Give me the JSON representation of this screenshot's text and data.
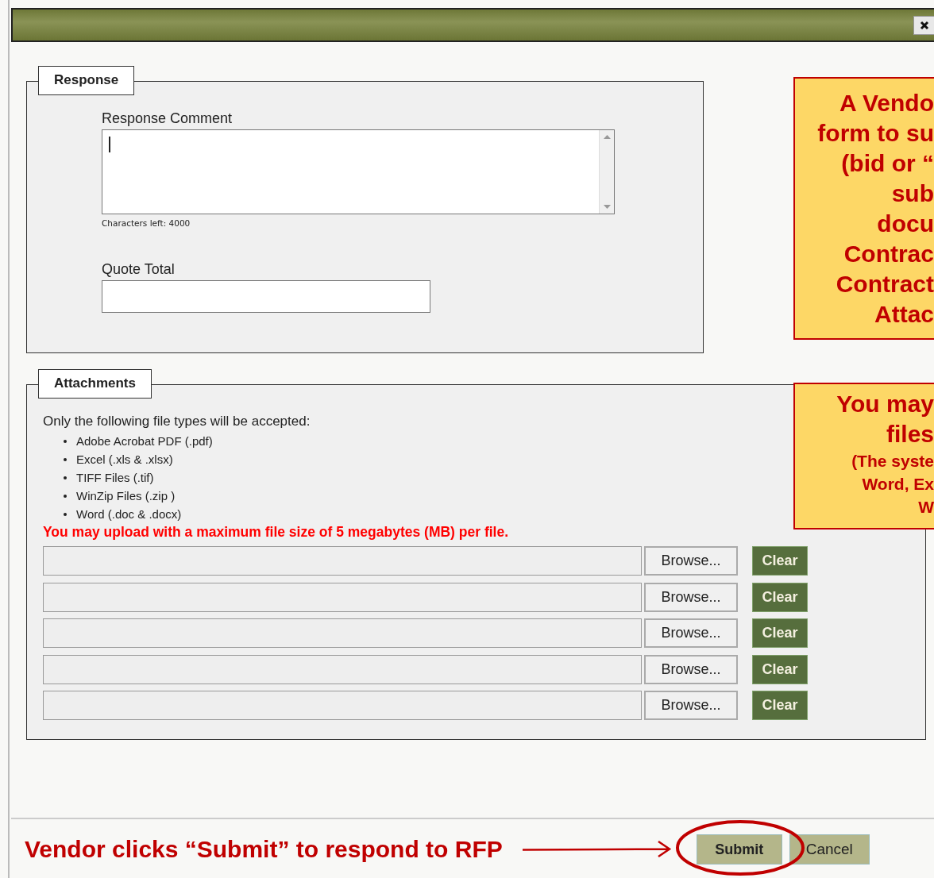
{
  "response": {
    "legend": "Response",
    "comment_label": "Response Comment",
    "chars_left": "Characters left: 4000",
    "quote_label": "Quote Total"
  },
  "attachments": {
    "legend": "Attachments",
    "intro": "Only the following file types will be accepted:",
    "file_types": [
      "Adobe Acrobat PDF (.pdf)",
      "Excel (.xls & .xlsx)",
      "TIFF Files (.tif)",
      "WinZip Files (.zip )",
      "Word (.doc & .docx)"
    ],
    "size_warning": "You may upload with a maximum file size of 5 megabytes (MB) per file.",
    "uploads": [
      {
        "browse": "Browse...",
        "clear": "Clear"
      },
      {
        "browse": "Browse...",
        "clear": "Clear"
      },
      {
        "browse": "Browse...",
        "clear": "Clear"
      },
      {
        "browse": "Browse...",
        "clear": "Clear"
      },
      {
        "browse": "Browse...",
        "clear": "Clear"
      }
    ]
  },
  "footer": {
    "pointer_text": "Vendor clicks “Submit” to respond to RFP",
    "buttons": [
      {
        "label": "Submit",
        "kind": "primary"
      },
      {
        "label": "Cancel",
        "kind": "secondary"
      }
    ]
  },
  "callouts": [
    {
      "lines": [
        {
          "text": "A Vendo",
          "kind": "heading"
        },
        {
          "text": "form to su",
          "kind": "heading"
        },
        {
          "text": "(bid or “",
          "kind": "heading"
        },
        {
          "text": "sub",
          "kind": "heading"
        },
        {
          "text": "docu",
          "kind": "heading"
        },
        {
          "text": "Contrac",
          "kind": "heading"
        },
        {
          "text": "Contract",
          "kind": "heading"
        },
        {
          "text": "Attac",
          "kind": "heading"
        }
      ]
    },
    {
      "lines": [
        {
          "text": "You may",
          "kind": "heading"
        },
        {
          "text": "files",
          "kind": "heading"
        },
        {
          "text": "(The syste",
          "kind": "note"
        },
        {
          "text": "Word, Ex",
          "kind": "note"
        },
        {
          "text": "W",
          "kind": "note"
        }
      ]
    }
  ]
}
